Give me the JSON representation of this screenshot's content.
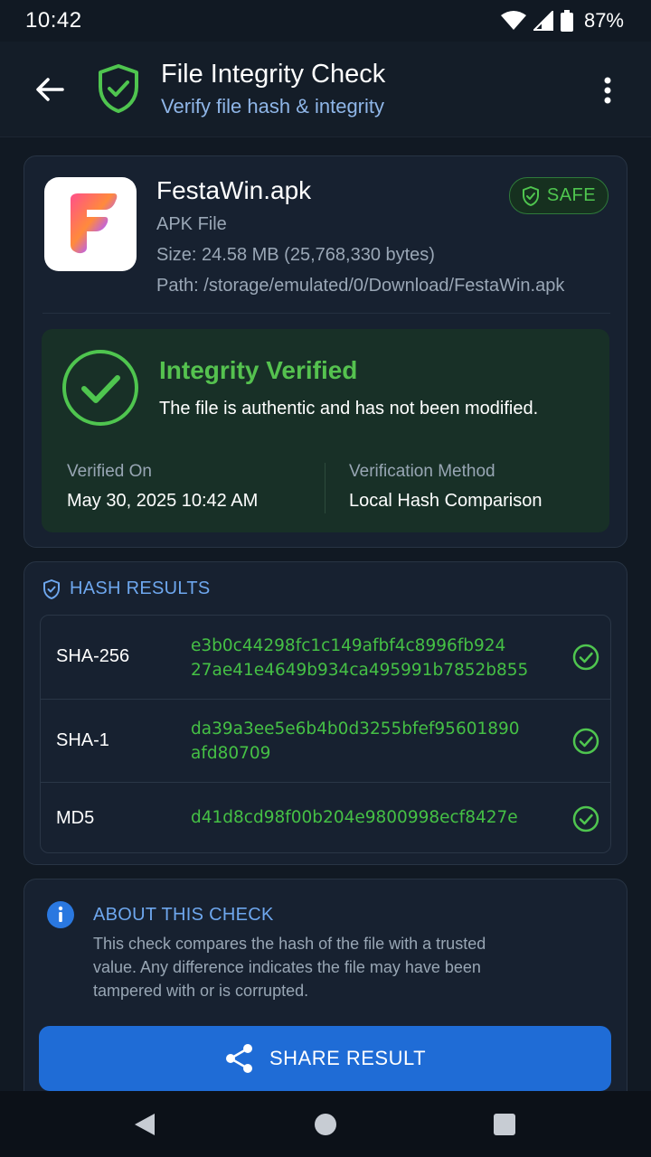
{
  "status_bar": {
    "time": "10:42",
    "battery": "87%",
    "icons": [
      "wifi-icon",
      "signal-icon",
      "battery-icon"
    ]
  },
  "app_bar": {
    "title": "File Integrity Check",
    "subtitle": "Verify file hash & integrity",
    "icons": [
      "back-arrow-icon",
      "shield-check-icon",
      "more-vert-icon"
    ]
  },
  "file": {
    "name": "FestaWin.apk",
    "type": "APK File",
    "size": "Size: 24.58 MB (25,768,330 bytes)",
    "path": "Path: /storage/emulated/0/Download/FestaWin.apk",
    "badge": "SAFE",
    "app_icon": "festawin-logo-icon"
  },
  "verification": {
    "title": "Integrity Verified",
    "description": "The file is authentic and has not been modified.",
    "verified_on_label": "Verified On",
    "verified_on_value": "May 30, 2025 10:42 AM",
    "method_label": "Verification Method",
    "method_value": "Local Hash Comparison"
  },
  "hash_results": {
    "header": "HASH RESULTS",
    "rows": [
      {
        "algorithm": "SHA-256",
        "line1": "e3b0c44298fc1c149afbf4c8996fb924",
        "line2": "27ae41e4649b934ca495991b7852b855"
      },
      {
        "algorithm": "SHA-1",
        "line1": "da39a3ee5e6b4b0d3255bfef95601890",
        "line2": "afd80709"
      },
      {
        "algorithm": "MD5",
        "line1": "d41d8cd98f00b204e9800998ecf8427e",
        "line2": ""
      }
    ]
  },
  "about": {
    "title": "ABOUT THIS CHECK",
    "text": "This check compares the hash of the file with a trusted value. Any difference indicates the file may have been tampered with or is corrupted."
  },
  "share_button": {
    "label": "SHARE RESULT"
  },
  "colors": {
    "background": "#111923",
    "card": "#172130",
    "accent_green": "#55c24f",
    "accent_blue": "#6ea7ee",
    "button_blue": "#1f6cd6"
  }
}
